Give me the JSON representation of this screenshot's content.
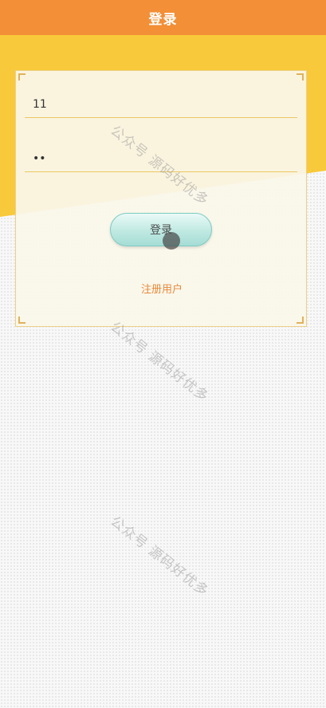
{
  "header": {
    "title": "登录"
  },
  "form": {
    "username_value": "11",
    "password_value": "••",
    "login_label": "登录",
    "register_label": "注册用户"
  },
  "watermark": {
    "text": "公众号 源码好优多"
  },
  "colors": {
    "header": "#f28f37",
    "wedge": "#f8c93a",
    "card_border": "#edd089",
    "field_underline": "#eac764",
    "button_fill": "#bfe9e2",
    "register_link": "#e8893a"
  }
}
